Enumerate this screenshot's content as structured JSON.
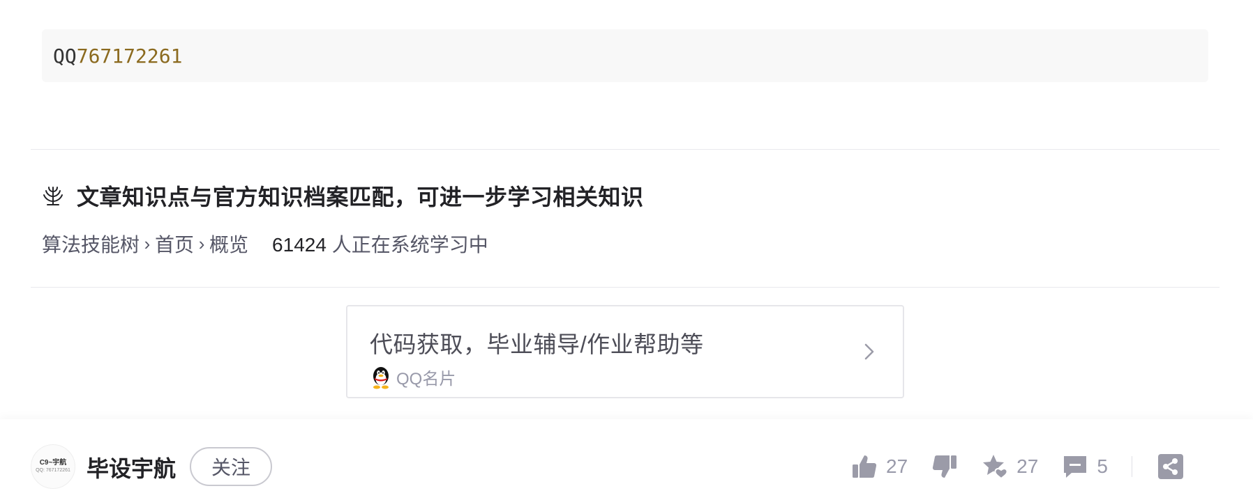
{
  "code": {
    "prefix": "QQ",
    "number": "767172261"
  },
  "knowledge": {
    "title": "文章知识点与官方知识档案匹配，可进一步学习相关知识",
    "breadcrumb": [
      "算法技能树",
      "首页",
      "概览"
    ],
    "learner_count": "61424",
    "learner_text": " 人正在系统学习中"
  },
  "card": {
    "title": "代码获取，毕业辅导/作业帮助等",
    "subtitle": "QQ名片"
  },
  "author": {
    "avatar_line1": "C9~宇航",
    "avatar_line2": "QQ: 767172261",
    "name": "毕设宇航",
    "follow_label": "关注"
  },
  "actions": {
    "like_count": "27",
    "favorite_count": "27",
    "comment_count": "5"
  },
  "colors": {
    "code_number": "#8b6a1f",
    "icon_gray": "#9b9ba8",
    "text_secondary": "#555666"
  }
}
